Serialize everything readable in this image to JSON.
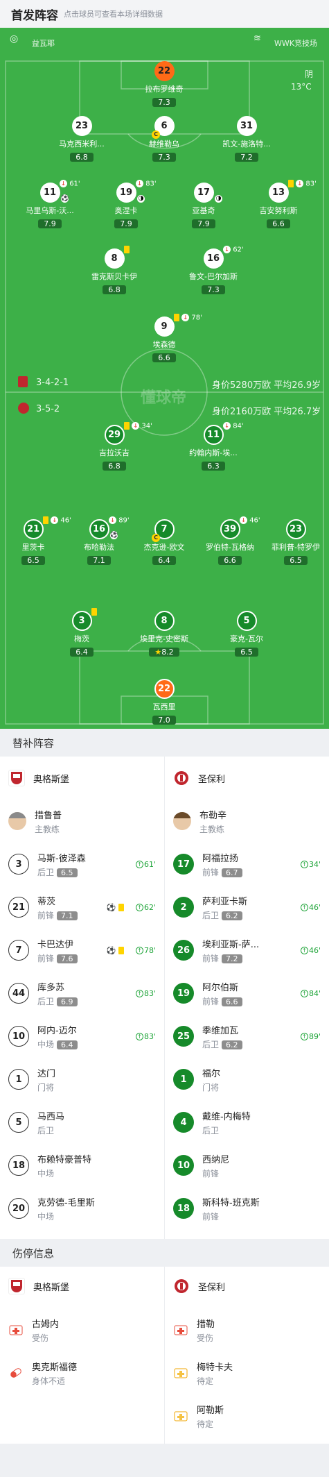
{
  "header": {
    "title": "首发阵容",
    "subtitle": "点击球员可查看本场详细数据"
  },
  "pitch": {
    "referee": "益瓦耶",
    "venue": "WWK竞技场",
    "weather": "阴",
    "temperature": "13°C",
    "watermark": "懂球帝"
  },
  "home": {
    "formation": "3-4-2-1",
    "value_age": "身价5280万欧 平均26.9岁",
    "name": "奥格斯堡",
    "coach": "措鲁普",
    "coach_role": "主教练"
  },
  "away": {
    "formation": "3-5-2",
    "value_age": "身价2160万欧 平均26.7岁",
    "name": "圣保利",
    "coach": "布勒辛",
    "coach_role": "主教练"
  },
  "home_players": [
    {
      "num": "22",
      "name": "拉布罗维奇",
      "rating": "7.3"
    },
    {
      "num": "23",
      "name": "马克西米利...",
      "rating": "6.8"
    },
    {
      "num": "6",
      "name": "赫维勒乌",
      "rating": "7.3"
    },
    {
      "num": "31",
      "name": "凯文-施洛特...",
      "rating": "7.2"
    },
    {
      "num": "11",
      "name": "马里乌斯-沃...",
      "rating": "7.9",
      "sub": "61'"
    },
    {
      "num": "19",
      "name": "奥涅卡",
      "rating": "7.9",
      "sub": "83'"
    },
    {
      "num": "17",
      "name": "亚基奇",
      "rating": "7.9"
    },
    {
      "num": "13",
      "name": "吉安努利斯",
      "rating": "6.6",
      "sub": "83'"
    },
    {
      "num": "8",
      "name": "雷克斯贝卡伊",
      "rating": "6.8"
    },
    {
      "num": "16",
      "name": "鲁文-巴尔加斯",
      "rating": "7.3",
      "sub": "62'"
    },
    {
      "num": "9",
      "name": "埃森德",
      "rating": "6.6",
      "sub": "78'"
    }
  ],
  "away_players": [
    {
      "num": "29",
      "name": "吉拉沃吉",
      "rating": "6.8",
      "sub": "34'"
    },
    {
      "num": "11",
      "name": "约翰内斯-埃...",
      "rating": "6.3",
      "sub": "84'"
    },
    {
      "num": "21",
      "name": "里茨卡",
      "rating": "6.5",
      "sub": "46'"
    },
    {
      "num": "16",
      "name": "布哈勒法",
      "rating": "7.1",
      "sub": "89'"
    },
    {
      "num": "7",
      "name": "杰克逊-欧文",
      "rating": "6.4"
    },
    {
      "num": "39",
      "name": "罗伯特-瓦格纳",
      "rating": "6.6",
      "sub": "46'"
    },
    {
      "num": "23",
      "name": "菲利普-特罗伊",
      "rating": "6.5"
    },
    {
      "num": "3",
      "name": "梅茨",
      "rating": "6.4"
    },
    {
      "num": "8",
      "name": "埃里克-史密斯",
      "rating": "8.2"
    },
    {
      "num": "5",
      "name": "豪克-瓦尔",
      "rating": "6.5"
    },
    {
      "num": "22",
      "name": "瓦西里",
      "rating": "7.0"
    }
  ],
  "subs_section": {
    "title": "替补阵容"
  },
  "home_subs": [
    {
      "num": "3",
      "name": "马斯-彼泽森",
      "pos": "后卫",
      "rating": "6.5",
      "sub": "61'"
    },
    {
      "num": "21",
      "name": "蒂茨",
      "pos": "前锋",
      "rating": "7.1",
      "sub": "62'"
    },
    {
      "num": "7",
      "name": "卡巴达伊",
      "pos": "前锋",
      "rating": "7.6",
      "sub": "78'"
    },
    {
      "num": "44",
      "name": "库多苏",
      "pos": "后卫",
      "rating": "6.9",
      "sub": "83'"
    },
    {
      "num": "10",
      "name": "阿内-迈尔",
      "pos": "中场",
      "rating": "6.4",
      "sub": "83'"
    },
    {
      "num": "1",
      "name": "达门",
      "pos": "门将"
    },
    {
      "num": "5",
      "name": "马西马",
      "pos": "后卫"
    },
    {
      "num": "18",
      "name": "布赖特豪普特",
      "pos": "中场"
    },
    {
      "num": "20",
      "name": "克劳德-毛里斯",
      "pos": "中场"
    }
  ],
  "away_subs": [
    {
      "num": "17",
      "name": "阿福拉扬",
      "pos": "前锋",
      "rating": "6.7",
      "sub": "34'"
    },
    {
      "num": "2",
      "name": "萨利亚卡斯",
      "pos": "后卫",
      "rating": "6.2",
      "sub": "46'"
    },
    {
      "num": "26",
      "name": "埃利亚斯-萨...",
      "pos": "前锋",
      "rating": "7.2",
      "sub": "46'"
    },
    {
      "num": "19",
      "name": "阿尔伯斯",
      "pos": "前锋",
      "rating": "6.6",
      "sub": "84'"
    },
    {
      "num": "25",
      "name": "季维加瓦",
      "pos": "后卫",
      "rating": "6.2",
      "sub": "89'"
    },
    {
      "num": "1",
      "name": "福尔",
      "pos": "门将"
    },
    {
      "num": "4",
      "name": "戴维-内梅特",
      "pos": "后卫"
    },
    {
      "num": "10",
      "name": "西纳尼",
      "pos": "前锋"
    },
    {
      "num": "18",
      "name": "斯科特-班克斯",
      "pos": "前锋"
    }
  ],
  "injury_section": {
    "title": "伤停信息"
  },
  "home_injuries": [
    {
      "name": "古姆内",
      "status": "受伤"
    },
    {
      "name": "奥克斯福德",
      "status": "身体不适"
    }
  ],
  "away_injuries": [
    {
      "name": "措勒",
      "status": "受伤"
    },
    {
      "name": "梅特卡夫",
      "status": "待定"
    },
    {
      "name": "阿勒斯",
      "status": "待定"
    }
  ],
  "colors": {
    "pitch": "#3db048",
    "gk": "#ff6a17",
    "away_circle": "#168a2a",
    "sub_arrow": "#20a53a",
    "yellow": "#ffd400"
  }
}
